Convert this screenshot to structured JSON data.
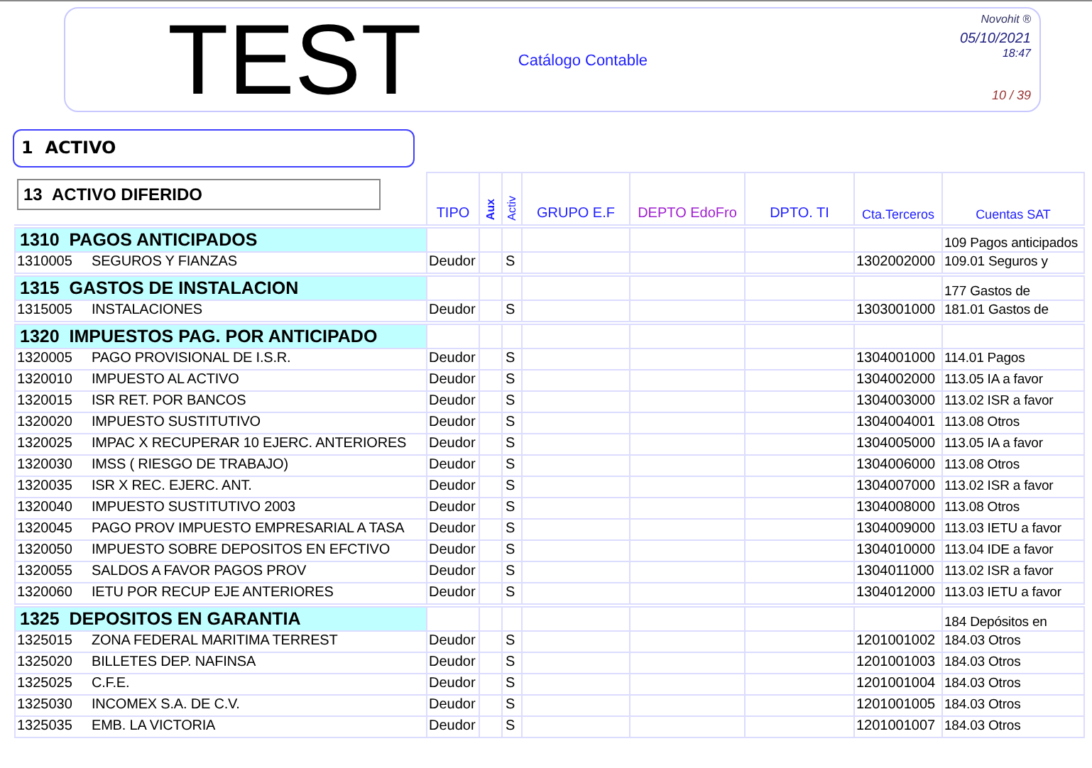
{
  "header": {
    "logo": "TEST",
    "title": "Catálogo Contable",
    "brand": "Novohit ®",
    "date": "05/10/2021",
    "time": "18:47",
    "page": "10 / 39"
  },
  "level1": {
    "code": "1",
    "name": "ACTIVO"
  },
  "level2": {
    "code": "13",
    "name": "ACTIVO DIFERIDO"
  },
  "columns": [
    "TIPO",
    "Aux",
    "Activ",
    "GRUPO E.F",
    "DEPTO EdoFro",
    "DPTO. TI",
    "Cta.Terceros",
    "Cuentas SAT"
  ],
  "groups": [
    {
      "code": "1310",
      "name": "PAGOS ANTICIPADOS",
      "sat": "109 Pagos anticipados",
      "accounts": [
        {
          "code": "1310005",
          "name": "SEGUROS Y FIANZAS",
          "tipo": "Deudor",
          "activ": "S",
          "cta": "1302002000",
          "sat": "109.01 Seguros y"
        }
      ]
    },
    {
      "code": "1315",
      "name": "GASTOS DE INSTALACION",
      "sat": "177 Gastos de",
      "accounts": [
        {
          "code": "1315005",
          "name": "INSTALACIONES",
          "tipo": "Deudor",
          "activ": "S",
          "cta": "1303001000",
          "sat": "181.01 Gastos de"
        }
      ]
    },
    {
      "code": "1320",
      "name": "IMPUESTOS PAG. POR ANTICIPADO",
      "accounts": [
        {
          "code": "1320005",
          "name": "PAGO PROVISIONAL DE I.S.R.",
          "tipo": "Deudor",
          "activ": "S",
          "cta": "1304001000",
          "sat": "114.01 Pagos"
        },
        {
          "code": "1320010",
          "name": "IMPUESTO AL ACTIVO",
          "tipo": "Deudor",
          "activ": "S",
          "cta": "1304002000",
          "sat": "113.05 IA a favor"
        },
        {
          "code": "1320015",
          "name": "ISR RET. POR BANCOS",
          "tipo": "Deudor",
          "activ": "S",
          "cta": "1304003000",
          "sat": "113.02 ISR a favor"
        },
        {
          "code": "1320020",
          "name": "IMPUESTO SUSTITUTIVO",
          "tipo": "Deudor",
          "activ": "S",
          "cta": "1304004001",
          "sat": "113.08 Otros"
        },
        {
          "code": "1320025",
          "name": "IMPAC X RECUPERAR 10 EJERC. ANTERIORES",
          "tipo": "Deudor",
          "activ": "S",
          "cta": "1304005000",
          "sat": "113.05 IA a favor"
        },
        {
          "code": "1320030",
          "name": "IMSS ( RIESGO DE TRABAJO)",
          "tipo": "Deudor",
          "activ": "S",
          "cta": "1304006000",
          "sat": "113.08 Otros"
        },
        {
          "code": "1320035",
          "name": "ISR X REC. EJERC. ANT.",
          "tipo": "Deudor",
          "activ": "S",
          "cta": "1304007000",
          "sat": "113.02 ISR a favor"
        },
        {
          "code": "1320040",
          "name": "IMPUESTO SUSTITUTIVO 2003",
          "tipo": "Deudor",
          "activ": "S",
          "cta": "1304008000",
          "sat": "113.08 Otros"
        },
        {
          "code": "1320045",
          "name": "PAGO PROV IMPUESTO EMPRESARIAL A TASA",
          "tipo": "Deudor",
          "activ": "S",
          "cta": "1304009000",
          "sat": "113.03 IETU a favor"
        },
        {
          "code": "1320050",
          "name": "IMPUESTO SOBRE DEPOSITOS EN EFCTIVO",
          "tipo": "Deudor",
          "activ": "S",
          "cta": "1304010000",
          "sat": "113.04 IDE a favor"
        },
        {
          "code": "1320055",
          "name": "SALDOS A FAVOR PAGOS PROV",
          "tipo": "Deudor",
          "activ": "S",
          "cta": "1304011000",
          "sat": "113.02 ISR a favor"
        },
        {
          "code": "1320060",
          "name": "IETU POR RECUP EJE ANTERIORES",
          "tipo": "Deudor",
          "activ": "S",
          "cta": "1304012000",
          "sat": "113.03 IETU a favor"
        }
      ]
    },
    {
      "code": "1325",
      "name": "DEPOSITOS EN GARANTIA",
      "sat": "184 Depósitos en",
      "accounts": [
        {
          "code": "1325015",
          "name": "ZONA FEDERAL MARITIMA TERREST",
          "tipo": "Deudor",
          "activ": "S",
          "cta": "1201001002",
          "sat": "184.03 Otros"
        },
        {
          "code": "1325020",
          "name": "BILLETES DEP. NAFINSA",
          "tipo": "Deudor",
          "activ": "S",
          "cta": "1201001003",
          "sat": "184.03 Otros"
        },
        {
          "code": "1325025",
          "name": "C.F.E.",
          "tipo": "Deudor",
          "activ": "S",
          "cta": "1201001004",
          "sat": "184.03 Otros"
        },
        {
          "code": "1325030",
          "name": "INCOMEX S.A. DE C.V.",
          "tipo": "Deudor",
          "activ": "S",
          "cta": "1201001005",
          "sat": "184.03 Otros"
        },
        {
          "code": "1325035",
          "name": "EMB. LA VICTORIA",
          "tipo": "Deudor",
          "activ": "S",
          "cta": "1201001007",
          "sat": "184.03 Otros"
        }
      ]
    }
  ]
}
